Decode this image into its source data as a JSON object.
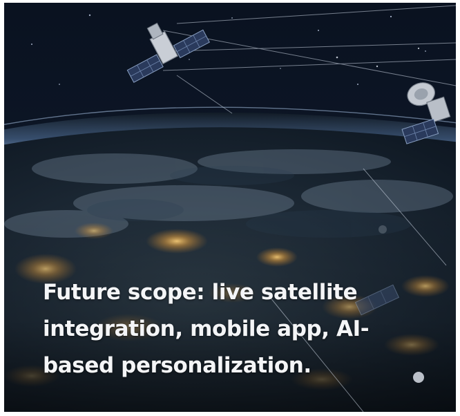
{
  "caption": {
    "lines": [
      "Future scope: live satellite",
      "integration, mobile app, AI-",
      "based personalization."
    ]
  },
  "colors": {
    "space": "#0a1322",
    "atmosphere_glow": "#4b6f9e",
    "city_lights": "#f0b14a",
    "text": "#f4f5f7"
  },
  "icons": [
    "satellite-icon",
    "satellite-dish-icon",
    "earth-globe"
  ]
}
